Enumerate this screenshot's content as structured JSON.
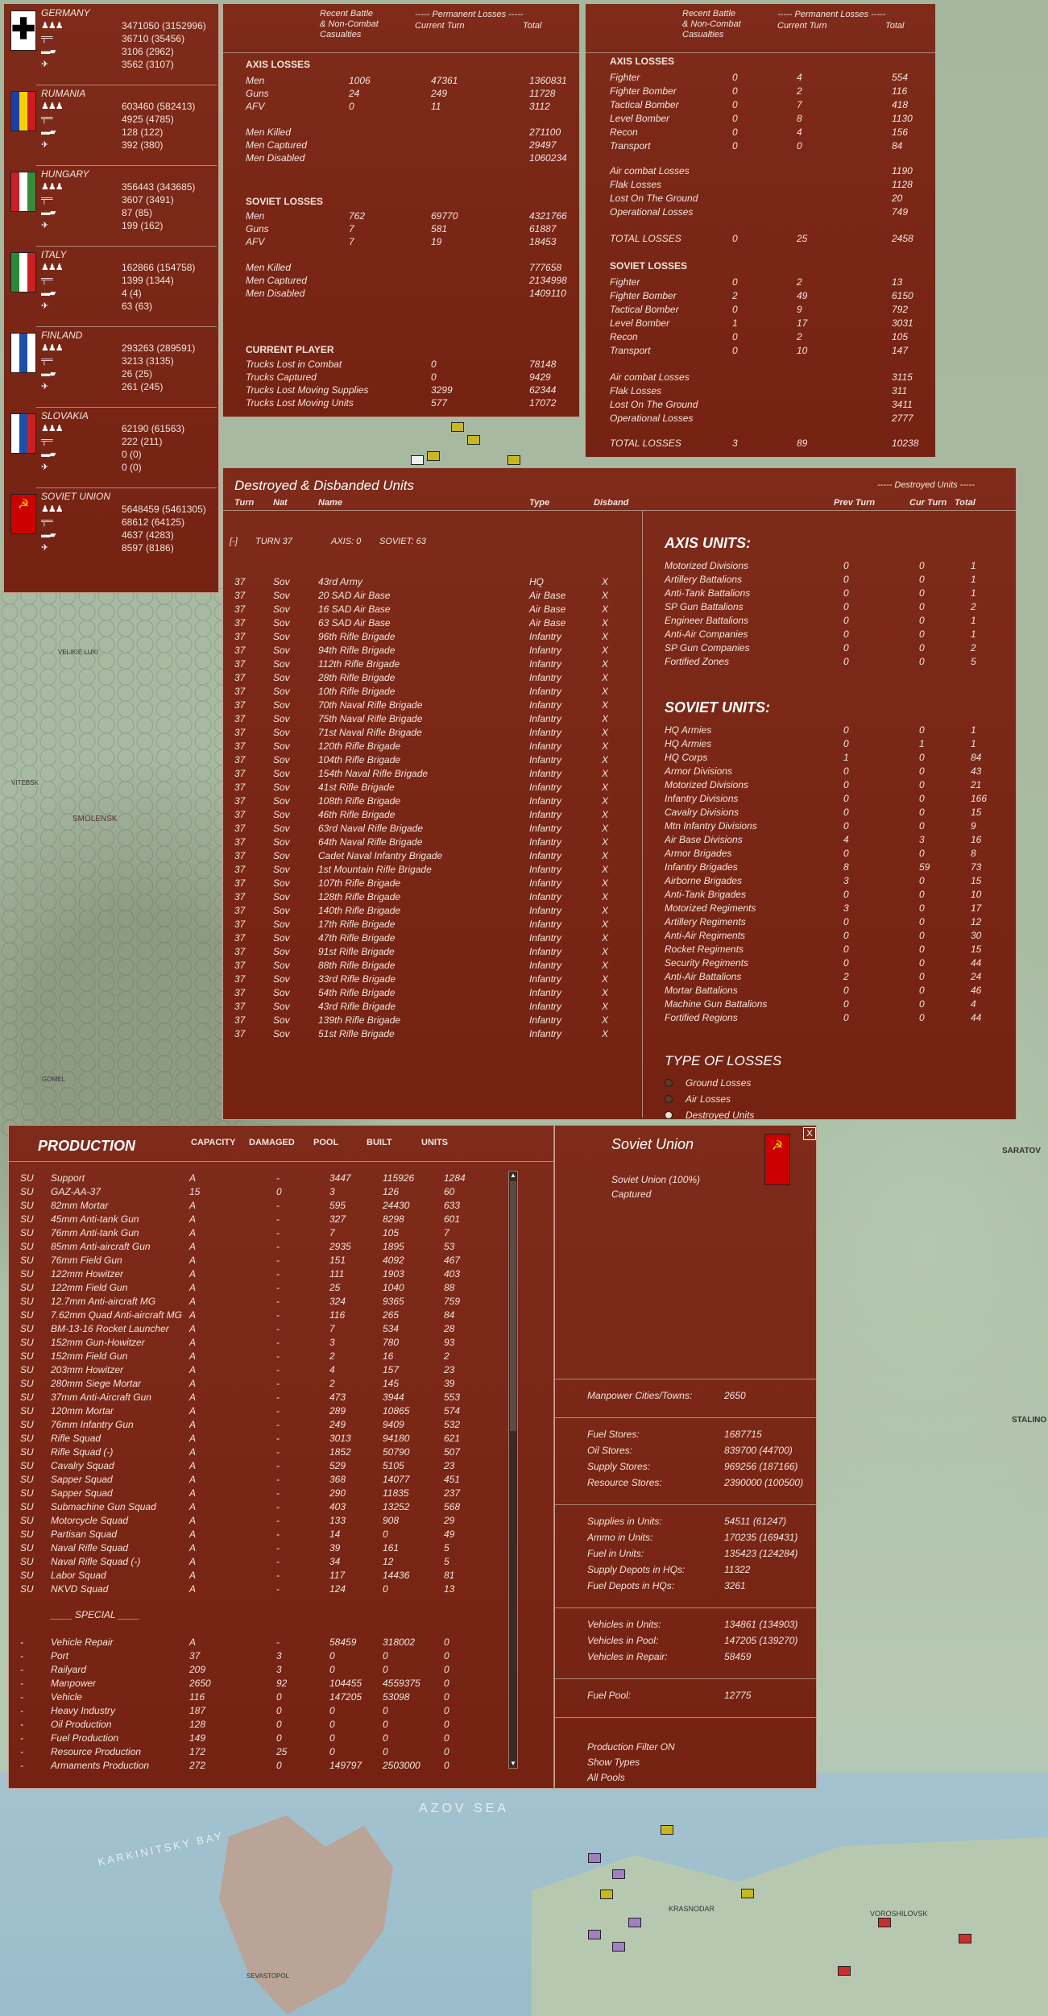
{
  "map_labels": {
    "smolensk": "SMOLENSK",
    "azov_sea": "AZOV SEA",
    "karkinitsky_bay": "KARKINITSKY BAY",
    "saratov": "SARATOV",
    "stalingrad": "STALINO",
    "voroshilovsk": "VOROSHILOVSK",
    "velikie_luki": "VELIKIE LUKI",
    "gomel": "GOMEL",
    "vitebsk": "VITEBSK",
    "sevastopol": "SEVASTOPOL",
    "krasnodar": "KRASNODAR"
  },
  "nations": [
    {
      "name": "GERMANY",
      "men": "3471050 (3152996)",
      "guns": "36710 (35456)",
      "afv": "3106 (2962)",
      "air": "3562 (3107)",
      "flag": [
        "#000000",
        "#ffffff",
        "#cc0000"
      ]
    },
    {
      "name": "RUMANIA",
      "men": "603460 (582413)",
      "guns": "4925 (4785)",
      "afv": "128 (122)",
      "air": "392 (380)",
      "flag": [
        "#1f3fa8",
        "#f5d100",
        "#cf1b1b"
      ]
    },
    {
      "name": "HUNGARY",
      "men": "356443 (343685)",
      "guns": "3607 (3491)",
      "afv": "87 (85)",
      "air": "199 (162)",
      "flag": [
        "#c8202d",
        "#ffffff",
        "#3a8a3a"
      ]
    },
    {
      "name": "ITALY",
      "men": "162866 (154758)",
      "guns": "1399 (1344)",
      "afv": "4 (4)",
      "air": "63 (63)",
      "flag": [
        "#2a8a3a",
        "#ffffff",
        "#cc2020"
      ]
    },
    {
      "name": "FINLAND",
      "men": "293263 (289591)",
      "guns": "3213 (3135)",
      "afv": "26 (25)",
      "air": "261 (245)",
      "flag": [
        "#ffffff",
        "#1f4ea8",
        "#ffffff"
      ]
    },
    {
      "name": "SLOVAKIA",
      "men": "62190 (61563)",
      "guns": "222 (211)",
      "afv": "0 (0)",
      "air": "0 (0)",
      "flag": [
        "#ffffff",
        "#1f4ea8",
        "#cc2020"
      ]
    },
    {
      "name": "SOVIET UNION",
      "men": "5648459 (5461305)",
      "guns": "68612 (64125)",
      "afv": "4637 (4283)",
      "air": "8597 (8186)",
      "flag": [
        "#cc0000",
        "#cc0000",
        "#cc0000"
      ]
    }
  ],
  "ground": {
    "hdr_recent": "Recent Battle\n& Non-Combat\nCasualties",
    "hdr_perm": "----- Permanent Losses -----",
    "hdr_cur": "Current Turn",
    "hdr_total": "Total",
    "axis_title": "AXIS LOSSES",
    "axis_rows": [
      [
        "Men",
        "1006",
        "47361",
        "1360831"
      ],
      [
        "Guns",
        "24",
        "249",
        "11728"
      ],
      [
        "AFV",
        "0",
        "11",
        "3112"
      ]
    ],
    "axis_rows2": [
      [
        "Men Killed",
        "",
        "",
        "271100"
      ],
      [
        "Men Captured",
        "",
        "",
        "29497"
      ],
      [
        "Men Disabled",
        "",
        "",
        "1060234"
      ]
    ],
    "sov_title": "SOVIET LOSSES",
    "sov_rows": [
      [
        "Men",
        "762",
        "69770",
        "4321766"
      ],
      [
        "Guns",
        "7",
        "581",
        "61887"
      ],
      [
        "AFV",
        "7",
        "19",
        "18453"
      ]
    ],
    "sov_rows2": [
      [
        "Men Killed",
        "",
        "",
        "777658"
      ],
      [
        "Men Captured",
        "",
        "",
        "2134998"
      ],
      [
        "Men Disabled",
        "",
        "",
        "1409110"
      ]
    ],
    "cp_title": "CURRENT PLAYER",
    "cp_rows": [
      [
        "Trucks Lost in Combat",
        "0",
        "78148"
      ],
      [
        "Trucks Captured",
        "0",
        "9429"
      ],
      [
        "Trucks Lost Moving Supplies",
        "3299",
        "62344"
      ],
      [
        "Trucks Lost Moving Units",
        "577",
        "17072"
      ]
    ]
  },
  "air": {
    "hdr_recent": "Recent Battle\n& Non-Combat\nCasualties",
    "hdr_perm": "----- Permanent Losses -----",
    "hdr_cur": "Current Turn",
    "hdr_total": "Total",
    "axis_title": "AXIS LOSSES",
    "axis_rows": [
      [
        "Fighter",
        "0",
        "4",
        "554"
      ],
      [
        "Fighter Bomber",
        "0",
        "2",
        "116"
      ],
      [
        "Tactical Bomber",
        "0",
        "7",
        "418"
      ],
      [
        "Level Bomber",
        "0",
        "8",
        "1130"
      ],
      [
        "Recon",
        "0",
        "4",
        "156"
      ],
      [
        "Transport",
        "0",
        "0",
        "84"
      ]
    ],
    "axis_rows2": [
      [
        "Air combat Losses",
        "",
        "",
        "1190"
      ],
      [
        "Flak Losses",
        "",
        "",
        "1128"
      ],
      [
        "Lost On The Ground",
        "",
        "",
        "20"
      ],
      [
        "Operational Losses",
        "",
        "",
        "749"
      ]
    ],
    "axis_total": [
      "TOTAL LOSSES",
      "0",
      "25",
      "2458"
    ],
    "sov_title": "SOVIET LOSSES",
    "sov_rows": [
      [
        "Fighter",
        "0",
        "2",
        "13"
      ],
      [
        "Fighter Bomber",
        "2",
        "49",
        "6150"
      ],
      [
        "Tactical Bomber",
        "0",
        "9",
        "792"
      ],
      [
        "Level Bomber",
        "1",
        "17",
        "3031"
      ],
      [
        "Recon",
        "0",
        "2",
        "105"
      ],
      [
        "Transport",
        "0",
        "10",
        "147"
      ]
    ],
    "sov_rows2": [
      [
        "Air combat Losses",
        "",
        "",
        "3115"
      ],
      [
        "Flak Losses",
        "",
        "",
        "311"
      ],
      [
        "Lost On The Ground",
        "",
        "",
        "3411"
      ],
      [
        "Operational Losses",
        "",
        "",
        "2777"
      ]
    ],
    "sov_total": [
      "TOTAL LOSSES",
      "3",
      "89",
      "10238"
    ]
  },
  "destroyed": {
    "title": "Destroyed & Disbanded Units",
    "cols": [
      "Turn",
      "Nat",
      "Name",
      "Type",
      "Disband"
    ],
    "turn_line": {
      "toggle": "[-]",
      "turn": "TURN 37",
      "axis": "AXIS: 0",
      "soviet": "SOVIET: 63"
    },
    "units": [
      [
        "37",
        "Sov",
        "43rd Army",
        "HQ",
        "X"
      ],
      [
        "37",
        "Sov",
        "20 SAD Air Base",
        "Air Base",
        "X"
      ],
      [
        "37",
        "Sov",
        "16 SAD Air Base",
        "Air Base",
        "X"
      ],
      [
        "37",
        "Sov",
        "63 SAD Air Base",
        "Air Base",
        "X"
      ],
      [
        "37",
        "Sov",
        "96th Rifle Brigade",
        "Infantry",
        "X"
      ],
      [
        "37",
        "Sov",
        "94th Rifle Brigade",
        "Infantry",
        "X"
      ],
      [
        "37",
        "Sov",
        "112th Rifle Brigade",
        "Infantry",
        "X"
      ],
      [
        "37",
        "Sov",
        "28th Rifle Brigade",
        "Infantry",
        "X"
      ],
      [
        "37",
        "Sov",
        "10th Rifle Brigade",
        "Infantry",
        "X"
      ],
      [
        "37",
        "Sov",
        "70th Naval Rifle Brigade",
        "Infantry",
        "X"
      ],
      [
        "37",
        "Sov",
        "75th Naval Rifle Brigade",
        "Infantry",
        "X"
      ],
      [
        "37",
        "Sov",
        "71st Naval Rifle Brigade",
        "Infantry",
        "X"
      ],
      [
        "37",
        "Sov",
        "120th Rifle Brigade",
        "Infantry",
        "X"
      ],
      [
        "37",
        "Sov",
        "104th Rifle Brigade",
        "Infantry",
        "X"
      ],
      [
        "37",
        "Sov",
        "154th Naval Rifle Brigade",
        "Infantry",
        "X"
      ],
      [
        "37",
        "Sov",
        "41st Rifle Brigade",
        "Infantry",
        "X"
      ],
      [
        "37",
        "Sov",
        "108th Rifle Brigade",
        "Infantry",
        "X"
      ],
      [
        "37",
        "Sov",
        "46th Rifle Brigade",
        "Infantry",
        "X"
      ],
      [
        "37",
        "Sov",
        "63rd Naval Rifle Brigade",
        "Infantry",
        "X"
      ],
      [
        "37",
        "Sov",
        "64th Naval Rifle Brigade",
        "Infantry",
        "X"
      ],
      [
        "37",
        "Sov",
        "Cadet Naval Infantry Brigade",
        "Infantry",
        "X"
      ],
      [
        "37",
        "Sov",
        "1st Mountain Rifle Brigade",
        "Infantry",
        "X"
      ],
      [
        "37",
        "Sov",
        "107th Rifle Brigade",
        "Infantry",
        "X"
      ],
      [
        "37",
        "Sov",
        "128th Rifle Brigade",
        "Infantry",
        "X"
      ],
      [
        "37",
        "Sov",
        "140th Rifle Brigade",
        "Infantry",
        "X"
      ],
      [
        "37",
        "Sov",
        "17th Rifle Brigade",
        "Infantry",
        "X"
      ],
      [
        "37",
        "Sov",
        "47th Rifle Brigade",
        "Infantry",
        "X"
      ],
      [
        "37",
        "Sov",
        "91st Rifle Brigade",
        "Infantry",
        "X"
      ],
      [
        "37",
        "Sov",
        "88th Rifle Brigade",
        "Infantry",
        "X"
      ],
      [
        "37",
        "Sov",
        "33rd Rifle Brigade",
        "Infantry",
        "X"
      ],
      [
        "37",
        "Sov",
        "54th Rifle Brigade",
        "Infantry",
        "X"
      ],
      [
        "37",
        "Sov",
        "43rd Rifle Brigade",
        "Infantry",
        "X"
      ],
      [
        "37",
        "Sov",
        "139th Rifle Brigade",
        "Infantry",
        "X"
      ],
      [
        "37",
        "Sov",
        "51st Rifle Brigade",
        "Infantry",
        "X"
      ]
    ],
    "right_hdr": "----- Destroyed Units -----",
    "right_cols": [
      "Prev Turn",
      "Cur Turn",
      "Total"
    ],
    "axis_title": "AXIS UNITS:",
    "axis_units": [
      [
        "Motorized Divisions",
        "0",
        "0",
        "1"
      ],
      [
        "Artillery Battalions",
        "0",
        "0",
        "1"
      ],
      [
        "Anti-Tank Battalions",
        "0",
        "0",
        "1"
      ],
      [
        "SP Gun Battalions",
        "0",
        "0",
        "2"
      ],
      [
        "Engineer Battalions",
        "0",
        "0",
        "1"
      ],
      [
        "Anti-Air Companies",
        "0",
        "0",
        "1"
      ],
      [
        "SP Gun Companies",
        "0",
        "0",
        "2"
      ],
      [
        "Fortified Zones",
        "0",
        "0",
        "5"
      ]
    ],
    "sov_title": "SOVIET UNITS:",
    "sov_units": [
      [
        "HQ Armies",
        "0",
        "0",
        "1"
      ],
      [
        "HQ Armies",
        "0",
        "1",
        "1"
      ],
      [
        "HQ Corps",
        "1",
        "0",
        "84"
      ],
      [
        "Armor Divisions",
        "0",
        "0",
        "43"
      ],
      [
        "Motorized Divisions",
        "0",
        "0",
        "21"
      ],
      [
        "Infantry Divisions",
        "0",
        "0",
        "166"
      ],
      [
        "Cavalry Divisions",
        "0",
        "0",
        "15"
      ],
      [
        "Mtn Infantry Divisions",
        "0",
        "0",
        "9"
      ],
      [
        "Air Base Divisions",
        "4",
        "3",
        "16"
      ],
      [
        "Armor Brigades",
        "0",
        "0",
        "8"
      ],
      [
        "Infantry Brigades",
        "8",
        "59",
        "73"
      ],
      [
        "Airborne Brigades",
        "3",
        "0",
        "15"
      ],
      [
        "Anti-Tank Brigades",
        "0",
        "0",
        "10"
      ],
      [
        "Motorized Regiments",
        "3",
        "0",
        "17"
      ],
      [
        "Artillery Regiments",
        "0",
        "0",
        "12"
      ],
      [
        "Anti-Air Regiments",
        "0",
        "0",
        "30"
      ],
      [
        "Rocket Regiments",
        "0",
        "0",
        "15"
      ],
      [
        "Security Regiments",
        "0",
        "0",
        "44"
      ],
      [
        "Anti-Air Battalions",
        "2",
        "0",
        "24"
      ],
      [
        "Mortar Battalions",
        "0",
        "0",
        "46"
      ],
      [
        "Machine Gun Battalions",
        "0",
        "0",
        "4"
      ],
      [
        "Fortified Regions",
        "0",
        "0",
        "44"
      ]
    ],
    "type_title": "TYPE OF LOSSES",
    "type_opts": [
      "Ground Losses",
      "Air Losses",
      "Destroyed Units"
    ]
  },
  "production": {
    "title": "PRODUCTION",
    "cols": [
      "CAPACITY",
      "DAMAGED",
      "POOL",
      "BUILT",
      "UNITS"
    ],
    "items": [
      [
        "SU",
        "Support",
        "A",
        "-",
        "3447",
        "115926",
        "1284"
      ],
      [
        "SU",
        "GAZ-AA-37",
        "15",
        "0",
        "3",
        "126",
        "60"
      ],
      [
        "SU",
        "82mm Mortar",
        "A",
        "-",
        "595",
        "24430",
        "633"
      ],
      [
        "SU",
        "45mm Anti-tank Gun",
        "A",
        "-",
        "327",
        "8298",
        "601"
      ],
      [
        "SU",
        "76mm Anti-tank Gun",
        "A",
        "-",
        "7",
        "105",
        "7"
      ],
      [
        "SU",
        "85mm Anti-aircraft Gun",
        "A",
        "-",
        "2935",
        "1895",
        "53"
      ],
      [
        "SU",
        "76mm Field Gun",
        "A",
        "-",
        "151",
        "4092",
        "467"
      ],
      [
        "SU",
        "122mm Howitzer",
        "A",
        "-",
        "111",
        "1903",
        "403"
      ],
      [
        "SU",
        "122mm Field Gun",
        "A",
        "-",
        "25",
        "1040",
        "88"
      ],
      [
        "SU",
        "12.7mm Anti-aircraft MG",
        "A",
        "-",
        "324",
        "9365",
        "759"
      ],
      [
        "SU",
        "7.62mm Quad Anti-aircraft MG",
        "A",
        "-",
        "116",
        "265",
        "84"
      ],
      [
        "SU",
        "BM-13-16 Rocket Launcher",
        "A",
        "-",
        "7",
        "534",
        "28"
      ],
      [
        "SU",
        "152mm Gun-Howitzer",
        "A",
        "-",
        "3",
        "780",
        "93"
      ],
      [
        "SU",
        "152mm Field Gun",
        "A",
        "-",
        "2",
        "16",
        "2"
      ],
      [
        "SU",
        "203mm Howitzer",
        "A",
        "-",
        "4",
        "157",
        "23"
      ],
      [
        "SU",
        "280mm Siege Mortar",
        "A",
        "-",
        "2",
        "145",
        "39"
      ],
      [
        "SU",
        "37mm Anti-Aircraft Gun",
        "A",
        "-",
        "473",
        "3944",
        "553"
      ],
      [
        "SU",
        "120mm Mortar",
        "A",
        "-",
        "289",
        "10865",
        "574"
      ],
      [
        "SU",
        "76mm Infantry Gun",
        "A",
        "-",
        "249",
        "9409",
        "532"
      ],
      [
        "SU",
        "Rifle Squad",
        "A",
        "-",
        "3013",
        "94180",
        "621"
      ],
      [
        "SU",
        "Rifle Squad (-)",
        "A",
        "-",
        "1852",
        "50790",
        "507"
      ],
      [
        "SU",
        "Cavalry Squad",
        "A",
        "-",
        "529",
        "5105",
        "23"
      ],
      [
        "SU",
        "Sapper Squad",
        "A",
        "-",
        "368",
        "14077",
        "451"
      ],
      [
        "SU",
        "Sapper Squad",
        "A",
        "-",
        "290",
        "11835",
        "237"
      ],
      [
        "SU",
        "Submachine Gun Squad",
        "A",
        "-",
        "403",
        "13252",
        "568"
      ],
      [
        "SU",
        "Motorcycle Squad",
        "A",
        "-",
        "133",
        "908",
        "29"
      ],
      [
        "SU",
        "Partisan Squad",
        "A",
        "-",
        "14",
        "0",
        "49"
      ],
      [
        "SU",
        "Naval Rifle Squad",
        "A",
        "-",
        "39",
        "161",
        "5"
      ],
      [
        "SU",
        "Naval Rifle Squad (-)",
        "A",
        "-",
        "34",
        "12",
        "5"
      ],
      [
        "SU",
        "Labor Squad",
        "A",
        "-",
        "117",
        "14436",
        "81"
      ],
      [
        "SU",
        "NKVD Squad",
        "A",
        "-",
        "124",
        "0",
        "13"
      ]
    ],
    "special_title": "____ SPECIAL ____",
    "special": [
      [
        "-",
        "Vehicle Repair",
        "A",
        "-",
        "58459",
        "318002",
        "0"
      ],
      [
        "-",
        "Port",
        "37",
        "3",
        "0",
        "0",
        "0"
      ],
      [
        "-",
        "Railyard",
        "209",
        "3",
        "0",
        "0",
        "0"
      ],
      [
        "-",
        "Manpower",
        "2650",
        "92",
        "104455",
        "4559375",
        "0"
      ],
      [
        "-",
        "Vehicle",
        "116",
        "0",
        "147205",
        "53098",
        "0"
      ],
      [
        "-",
        "Heavy Industry",
        "187",
        "0",
        "0",
        "0",
        "0"
      ],
      [
        "-",
        "Oil Production",
        "128",
        "0",
        "0",
        "0",
        "0"
      ],
      [
        "-",
        "Fuel Production",
        "149",
        "0",
        "0",
        "0",
        "0"
      ],
      [
        "-",
        "Resource Production",
        "172",
        "25",
        "0",
        "0",
        "0"
      ],
      [
        "-",
        "Armaments Production",
        "272",
        "0",
        "149797",
        "2503000",
        "0"
      ]
    ]
  },
  "soviet_union": {
    "title": "Soviet Union",
    "close": "X",
    "nation": "Soviet Union  (100%)",
    "captured": "Captured",
    "g1": [
      [
        "Manpower Cities/Towns:",
        "2650"
      ]
    ],
    "g2": [
      [
        "Fuel Stores:",
        "1687715"
      ],
      [
        "Oil Stores:",
        "839700 (44700)"
      ],
      [
        "Supply Stores:",
        "969256 (187166)"
      ],
      [
        "Resource Stores:",
        "2390000 (100500)"
      ]
    ],
    "g3": [
      [
        "Supplies in Units:",
        "54511 (61247)"
      ],
      [
        "Ammo in Units:",
        "170235 (169431)"
      ],
      [
        "Fuel in Units:",
        "135423 (124284)"
      ],
      [
        "Supply Depots in HQs:",
        "11322"
      ],
      [
        "Fuel Depots in HQs:",
        "3261"
      ]
    ],
    "g4": [
      [
        "Vehicles in Units:",
        "134861 (134903)"
      ],
      [
        "Vehicles in Pool:",
        "147205 (139270)"
      ],
      [
        "Vehicles in Repair:",
        "58459"
      ]
    ],
    "g5": [
      [
        "Fuel Pool:",
        "12775"
      ]
    ],
    "links": [
      "Production Filter ON",
      "Show Types",
      "All Pools"
    ]
  },
  "colors": {
    "panel": "#7b2413",
    "text": "#f2e4dc",
    "border": "#c6a08f"
  }
}
